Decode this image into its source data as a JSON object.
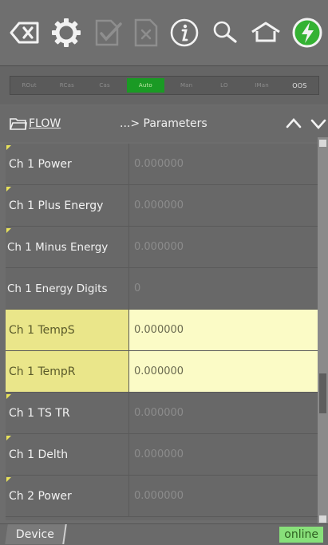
{
  "toolbar": {
    "icons": [
      "backspace-icon",
      "gear-icon",
      "checklist-icon",
      "document-x-icon",
      "info-icon",
      "search-icon",
      "home-icon",
      "power-icon"
    ]
  },
  "modes": {
    "items": [
      "ROut",
      "RCas",
      "Cas",
      "Auto",
      "Man",
      "LO",
      "IMan",
      "OOS"
    ],
    "active": "Auto"
  },
  "breadcrumb": {
    "root": "FLOW",
    "separator": "...> Parameters"
  },
  "rows": [
    {
      "name": "Ch 1 Power",
      "value": "0.000000",
      "flag": true,
      "highlight": false
    },
    {
      "name": "Ch 1 Plus Energy",
      "value": "0.000000",
      "flag": true,
      "highlight": false
    },
    {
      "name": "Ch 1 Minus Energy",
      "value": "0.000000",
      "flag": true,
      "highlight": false
    },
    {
      "name": "Ch 1 Energy Digits",
      "value": "0",
      "flag": false,
      "highlight": false
    },
    {
      "name": "Ch 1 TempS",
      "value": "0.000000",
      "flag": false,
      "highlight": true
    },
    {
      "name": "Ch 1 TempR",
      "value": "0.000000",
      "flag": false,
      "highlight": true
    },
    {
      "name": "Ch 1 TS TR",
      "value": "0.000000",
      "flag": true,
      "highlight": false
    },
    {
      "name": "Ch 1 Delth",
      "value": "0.000000",
      "flag": true,
      "highlight": false
    },
    {
      "name": "Ch 2 Power",
      "value": "0.000000",
      "flag": true,
      "highlight": false
    }
  ],
  "footer": {
    "tab": "Device",
    "status": "online"
  },
  "colors": {
    "highlight_name": "#eae68a",
    "highlight_value": "#fbfbc6",
    "active_mode": "#1a9a24",
    "online": "#88e07a",
    "power_icon": "#34b233"
  }
}
